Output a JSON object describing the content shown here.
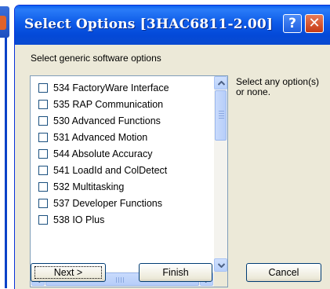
{
  "window": {
    "title": "Select Options [3HAC6811-2.00]",
    "title_buttons": {
      "help": "?",
      "close": "✕"
    }
  },
  "prompt": "Select generic software options",
  "options": [
    {
      "label": "534 FactoryWare Interface",
      "checked": false
    },
    {
      "label": "535 RAP Communication",
      "checked": false
    },
    {
      "label": "530 Advanced Functions",
      "checked": false
    },
    {
      "label": "531 Advanced Motion",
      "checked": false
    },
    {
      "label": "544 Absolute Accuracy",
      "checked": false
    },
    {
      "label": "541 LoadId and ColDetect",
      "checked": false
    },
    {
      "label": "532 Multitasking",
      "checked": false
    },
    {
      "label": "537 Developer Functions",
      "checked": false
    },
    {
      "label": "538 IO Plus",
      "checked": false
    }
  ],
  "hint": "Select any option(s) or none.",
  "buttons": {
    "next": "Next >",
    "finish": "Finish",
    "cancel": "Cancel"
  },
  "icons": {
    "help": "help-icon",
    "close": "close-icon",
    "scroll_up": "chevron-up-icon",
    "scroll_down": "chevron-down-icon",
    "scroll_left": "chevron-left-icon",
    "scroll_right": "chevron-right-icon"
  },
  "colors": {
    "titlebar": "#0a5ff0",
    "window_bg": "#ece9d8",
    "close_button": "#c53a14",
    "border": "#0831d9"
  }
}
